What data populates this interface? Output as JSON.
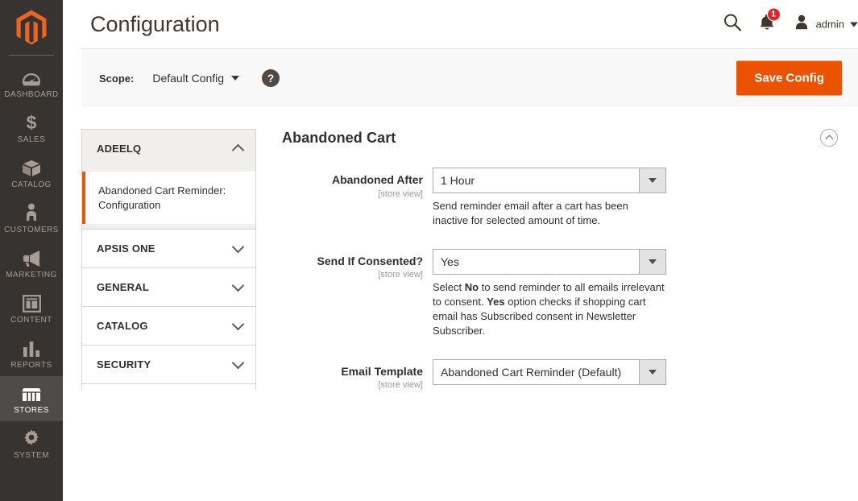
{
  "sidebar": {
    "logo_name": "magento-logo",
    "items": [
      {
        "label": "DASHBOARD",
        "icon": "dashboard-icon",
        "active": false
      },
      {
        "label": "SALES",
        "icon": "dollar-icon",
        "active": false
      },
      {
        "label": "CATALOG",
        "icon": "box-icon",
        "active": false
      },
      {
        "label": "CUSTOMERS",
        "icon": "person-icon",
        "active": false
      },
      {
        "label": "MARKETING",
        "icon": "megaphone-icon",
        "active": false
      },
      {
        "label": "CONTENT",
        "icon": "layout-icon",
        "active": false
      },
      {
        "label": "REPORTS",
        "icon": "bar-chart-icon",
        "active": false
      },
      {
        "label": "STORES",
        "icon": "storefront-icon",
        "active": true
      },
      {
        "label": "SYSTEM",
        "icon": "gear-icon",
        "active": false
      }
    ]
  },
  "header": {
    "title": "Configuration",
    "search_icon": "search-icon",
    "notifications_icon": "bell-icon",
    "notifications_count": "1",
    "user_icon": "user-avatar-icon",
    "user_name": "admin"
  },
  "scope_bar": {
    "label": "Scope:",
    "value": "Default Config",
    "help_glyph": "?",
    "save_label": "Save Config"
  },
  "config_nav": [
    {
      "label": "ADEELQ",
      "expanded": true,
      "children": [
        {
          "label": "Abandoned Cart Reminder: Configuration",
          "current": true
        }
      ]
    },
    {
      "label": "APSIS ONE",
      "expanded": false,
      "children": []
    },
    {
      "label": "GENERAL",
      "expanded": false,
      "children": []
    },
    {
      "label": "CATALOG",
      "expanded": false,
      "children": []
    },
    {
      "label": "SECURITY",
      "expanded": false,
      "children": []
    }
  ],
  "section": {
    "title": "Abandoned Cart",
    "collapse_icon": "chevron-up-circle-icon"
  },
  "fields": [
    {
      "label": "Abandoned After",
      "scope": "[store view]",
      "value": "1 Hour",
      "note_plain": "Send reminder email after a cart has been inactive for selected amount of time.",
      "note_parts": [
        {
          "t": "Send reminder email after a cart has been inactive for selected amount of time.",
          "b": false
        }
      ]
    },
    {
      "label": "Send If Consented?",
      "scope": "[store view]",
      "value": "Yes",
      "note_plain": "Select No to send reminder to all emails irrelevant to consent. Yes option checks if shopping cart email has Subscribed consent in Newsletter Subscriber.",
      "note_parts": [
        {
          "t": "Select ",
          "b": false
        },
        {
          "t": "No",
          "b": true
        },
        {
          "t": " to send reminder to all emails irrelevant to consent. ",
          "b": false
        },
        {
          "t": "Yes",
          "b": true
        },
        {
          "t": " option checks if shopping cart email has Subscribed consent in Newsletter Subscriber.",
          "b": false
        }
      ]
    },
    {
      "label": "Email Template",
      "scope": "[store view]",
      "value": "Abandoned Cart Reminder (Default)",
      "note_plain": "",
      "note_parts": []
    }
  ],
  "colors": {
    "brand_orange": "#eb5202",
    "sidebar_bg": "#373330",
    "sidebar_active": "#4f4b48",
    "badge_red": "#e22626",
    "scope_bar_bg": "#f8f8f8"
  }
}
